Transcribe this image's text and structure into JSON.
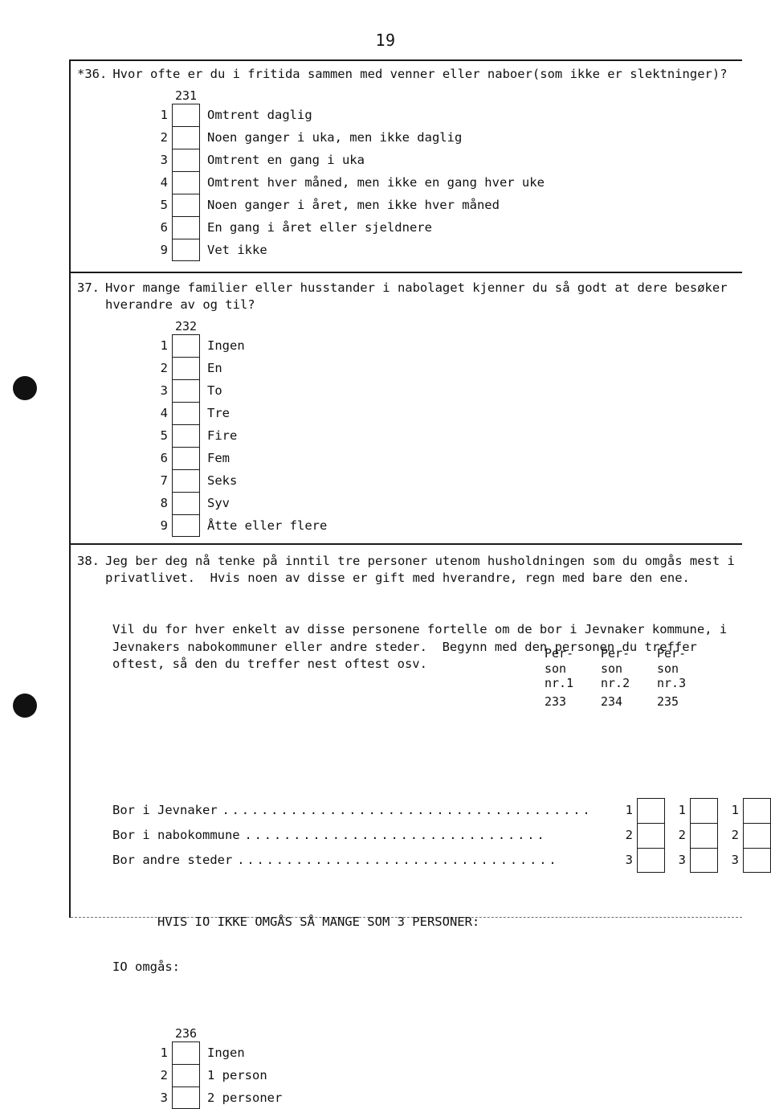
{
  "page": {
    "number": "19"
  },
  "questions": [
    {
      "id": "q36",
      "number": "*36.",
      "text": "Hvor ofte er du i fritida sammen med venner eller naboer(som ikke er slektninger)?",
      "code": "231",
      "options": [
        {
          "num": "1",
          "label": "Omtrent daglig"
        },
        {
          "num": "2",
          "label": "Noen ganger i uka, men ikke daglig"
        },
        {
          "num": "3",
          "label": "Omtrent en gang i uka"
        },
        {
          "num": "4",
          "label": "Omtrent hver måned, men ikke en gang hver uke"
        },
        {
          "num": "5",
          "label": "Noen ganger i året, men ikke hver måned"
        },
        {
          "num": "6",
          "label": "En gang i året eller sjeldnere"
        },
        {
          "num": "9",
          "label": "Vet ikke"
        }
      ]
    },
    {
      "id": "q37",
      "number": "37.",
      "text_line1": "Hvor mange familier eller husstander i nabolaget kjenner du så godt at dere besøker",
      "text_line2": "hverandre av og til?",
      "code": "232",
      "options": [
        {
          "num": "1",
          "label": "Ingen"
        },
        {
          "num": "2",
          "label": "En"
        },
        {
          "num": "3",
          "label": "To"
        },
        {
          "num": "4",
          "label": "Tre"
        },
        {
          "num": "5",
          "label": "Fire"
        },
        {
          "num": "6",
          "label": "Fem"
        },
        {
          "num": "7",
          "label": "Seks"
        },
        {
          "num": "8",
          "label": "Syv"
        },
        {
          "num": "9",
          "label": "Åtte eller flere"
        }
      ]
    },
    {
      "id": "q38",
      "number": "38.",
      "paragraph1": "Jeg ber deg nå tenke på inntil tre personer utenom husholdningen som du omgås mest i\nprivatlivet.  Hvis noen av disse er gift med hverandre, regn med bare den ene.",
      "paragraph2": "Vil du for hver enkelt av disse personene fortelle om de bor i Jevnaker kommune, i\nJevnakers nabokommuner eller andre steder.  Begynn med den personen du treffer\noftest, så den du treffer nest oftest osv.",
      "person_columns": [
        {
          "head": "Per-\nson\nnr.1",
          "code": "233"
        },
        {
          "head": "Per-\nson\nnr.2",
          "code": "234"
        },
        {
          "head": "Per-\nson\nnr.3",
          "code": "235"
        }
      ],
      "grid_rows": [
        {
          "label": "Bor i Jevnaker",
          "dots": "......................................",
          "cells": [
            "1",
            "1",
            "1"
          ]
        },
        {
          "label": "Bor i nabokommune",
          "dots": "...............................",
          "cells": [
            "2",
            "2",
            "2"
          ]
        },
        {
          "label": "Bor andre steder",
          "dots": ".................................",
          "cells": [
            "3",
            "3",
            "3"
          ]
        }
      ],
      "instruction_line1": "HVIS IO IKKE OMGÅS SÅ MANGE SOM 3 PERSONER:",
      "instruction_line2": "IO omgås:",
      "final_code": "236",
      "final_options": [
        {
          "num": "1",
          "label": "Ingen"
        },
        {
          "num": "2",
          "label": "1 person"
        },
        {
          "num": "3",
          "label": "2 personer"
        }
      ]
    }
  ]
}
